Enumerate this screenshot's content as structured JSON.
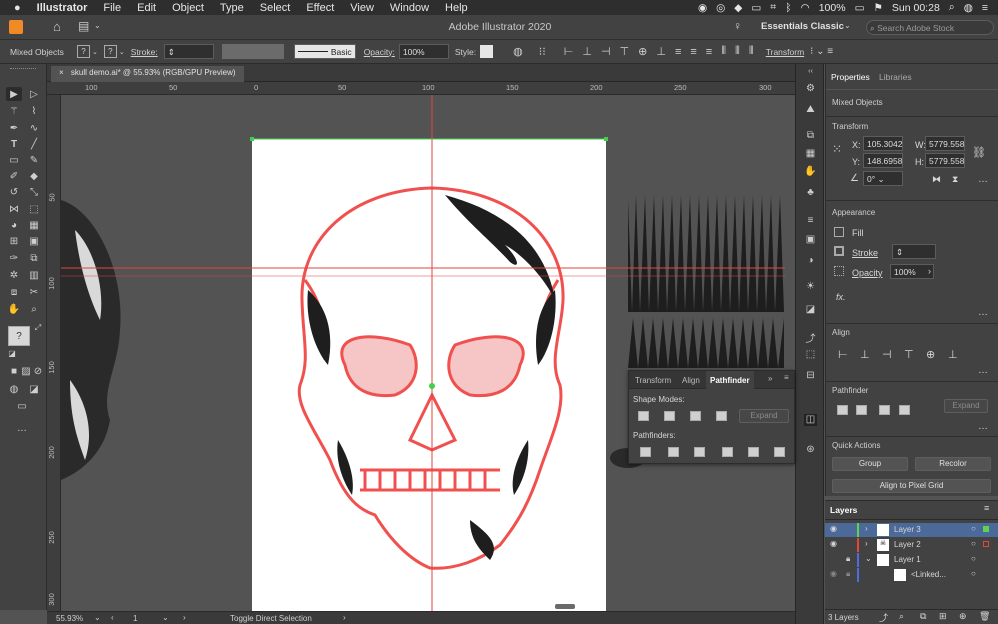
{
  "menubar": {
    "apple": "",
    "app": "Illustrator",
    "items": [
      "File",
      "Edit",
      "Object",
      "Type",
      "Select",
      "Effect",
      "View",
      "Window",
      "Help"
    ],
    "battery": "100%",
    "clock": "Sun 00:28"
  },
  "appbar": {
    "title": "Adobe Illustrator 2020",
    "workspace": "Essentials Classic",
    "search_placeholder": "Search Adobe Stock"
  },
  "control": {
    "selection": "Mixed Objects",
    "stroke_label": "Stroke:",
    "brush": "Basic",
    "opacity_label": "Opacity:",
    "opacity": "100%",
    "style_label": "Style:",
    "transform": "Transform"
  },
  "document": {
    "tab": "skull demo.ai* @ 55.93% (RGB/GPU Preview)"
  },
  "ruler": {
    "h": [
      "100",
      "50",
      "0",
      "50",
      "100",
      "150",
      "200",
      "250",
      "300"
    ],
    "v": [
      "50",
      "100",
      "150",
      "200",
      "250",
      "300"
    ]
  },
  "status": {
    "zoom": "55.93%",
    "artboard": "1",
    "tool": "Toggle Direct Selection"
  },
  "properties": {
    "tab_properties": "Properties",
    "tab_libraries": "Libraries",
    "selection": "Mixed Objects",
    "transform_label": "Transform",
    "x_label": "X:",
    "x": "105.3042",
    "y_label": "Y:",
    "y": "148.6958",
    "w_label": "W:",
    "w": "5779.558",
    "h_label": "H:",
    "h": "5779.558",
    "angle": "0°",
    "appearance_label": "Appearance",
    "fill": "Fill",
    "stroke": "Stroke",
    "opacity_label": "Opacity",
    "opacity": "100%",
    "fx": "fx.",
    "align_label": "Align",
    "pathfinder_label": "Pathfinder",
    "pf_expand": "Expand",
    "quick_label": "Quick Actions",
    "group": "Group",
    "recolor": "Recolor",
    "align_pixel": "Align to Pixel Grid"
  },
  "layers": {
    "title": "Layers",
    "rows": [
      {
        "name": "Layer 3",
        "color": "#5fd34d"
      },
      {
        "name": "Layer 2",
        "color": "#e2463c"
      },
      {
        "name": "Layer 1",
        "color": "#4d6de0"
      },
      {
        "name": "<Linked...",
        "color": "#4d6de0"
      }
    ],
    "count": "3 Layers"
  },
  "pathfinder_panel": {
    "tabs": [
      "Transform",
      "Align",
      "Pathfinder"
    ],
    "shape_modes": "Shape Modes:",
    "expand": "Expand",
    "pathfinders": "Pathfinders:"
  },
  "colors": {
    "accent": "#4f8bf0",
    "guide": "#e0463f",
    "selection": "#f0504e"
  }
}
